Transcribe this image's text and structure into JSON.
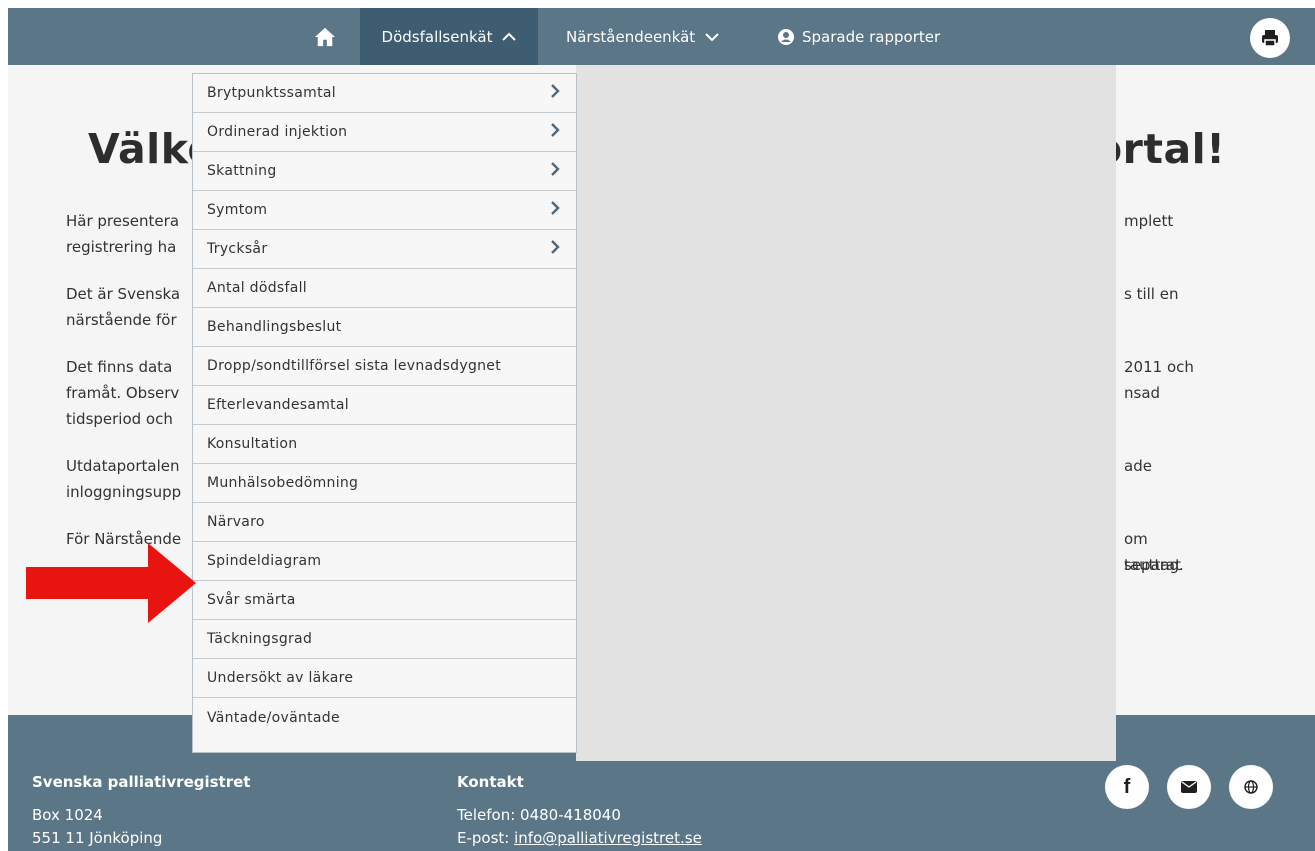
{
  "nav": {
    "home_icon": "home-icon",
    "items": [
      {
        "label": "Dödsfallsenkät",
        "state": "expanded"
      },
      {
        "label": "Närståendeenkät",
        "state": "collapsed"
      },
      {
        "label": "Sparade rapporter",
        "icon": "user-circle-icon"
      }
    ],
    "print_icon": "print-icon"
  },
  "welcome": {
    "title_left": "Välko",
    "title_right": "ortal!",
    "paragraphs": [
      {
        "left_1": "Här presentera",
        "left_2": "registrering ha",
        "right_1": "mplett"
      },
      {
        "left_1": "Det är Svenska",
        "left_2": "närstående för",
        "right_1": "s till en"
      },
      {
        "left_1": "Det finns data",
        "left_2": "framåt. Observ",
        "left_3": "tidsperiod och",
        "right_1": "2011 och",
        "right_2": "nsad"
      },
      {
        "left_1": "Utdataportalen",
        "left_2": "inloggningsupp",
        "right_1": "ade"
      },
      {
        "left_1": "För Närstående",
        "right_1": "om separat",
        "right_2": "tauttag."
      }
    ]
  },
  "dropdown": {
    "items": [
      {
        "label": "Brytpunktssamtal",
        "has_submenu": true
      },
      {
        "label": "Ordinerad injektion",
        "has_submenu": true
      },
      {
        "label": "Skattning",
        "has_submenu": true
      },
      {
        "label": "Symtom",
        "has_submenu": true
      },
      {
        "label": "Trycksår",
        "has_submenu": true
      },
      {
        "label": "Antal dödsfall",
        "has_submenu": false
      },
      {
        "label": "Behandlingsbeslut",
        "has_submenu": false
      },
      {
        "label": "Dropp/sondtillförsel sista levnadsdygnet",
        "has_submenu": false
      },
      {
        "label": "Efterlevandesamtal",
        "has_submenu": false
      },
      {
        "label": "Konsultation",
        "has_submenu": false
      },
      {
        "label": "Munhälsobedömning",
        "has_submenu": false
      },
      {
        "label": "Närvaro",
        "has_submenu": false
      },
      {
        "label": "Spindeldiagram",
        "has_submenu": false
      },
      {
        "label": "Svår smärta",
        "has_submenu": false
      },
      {
        "label": "Täckningsgrad",
        "has_submenu": false
      },
      {
        "label": "Undersökt av läkare",
        "has_submenu": false
      },
      {
        "label": "Väntade/oväntade",
        "has_submenu": false
      }
    ]
  },
  "footer": {
    "org": {
      "name": "Svenska palliativregistret",
      "address_1": "Box 1024",
      "address_2": "551 11 Jönköping"
    },
    "contact": {
      "heading": "Kontakt",
      "phone_label": "Telefon:",
      "phone": "0480-418040",
      "email_label": "E-post:",
      "email": "info@palliativregistret.se"
    },
    "social_icons": [
      "facebook-icon",
      "mail-icon",
      "globe-icon"
    ]
  },
  "annotation": {
    "arrow_color": "#e8140f"
  },
  "colors": {
    "nav_bg": "#5b7686",
    "nav_active": "#3e5d70",
    "footer_bg": "#5b7686"
  }
}
